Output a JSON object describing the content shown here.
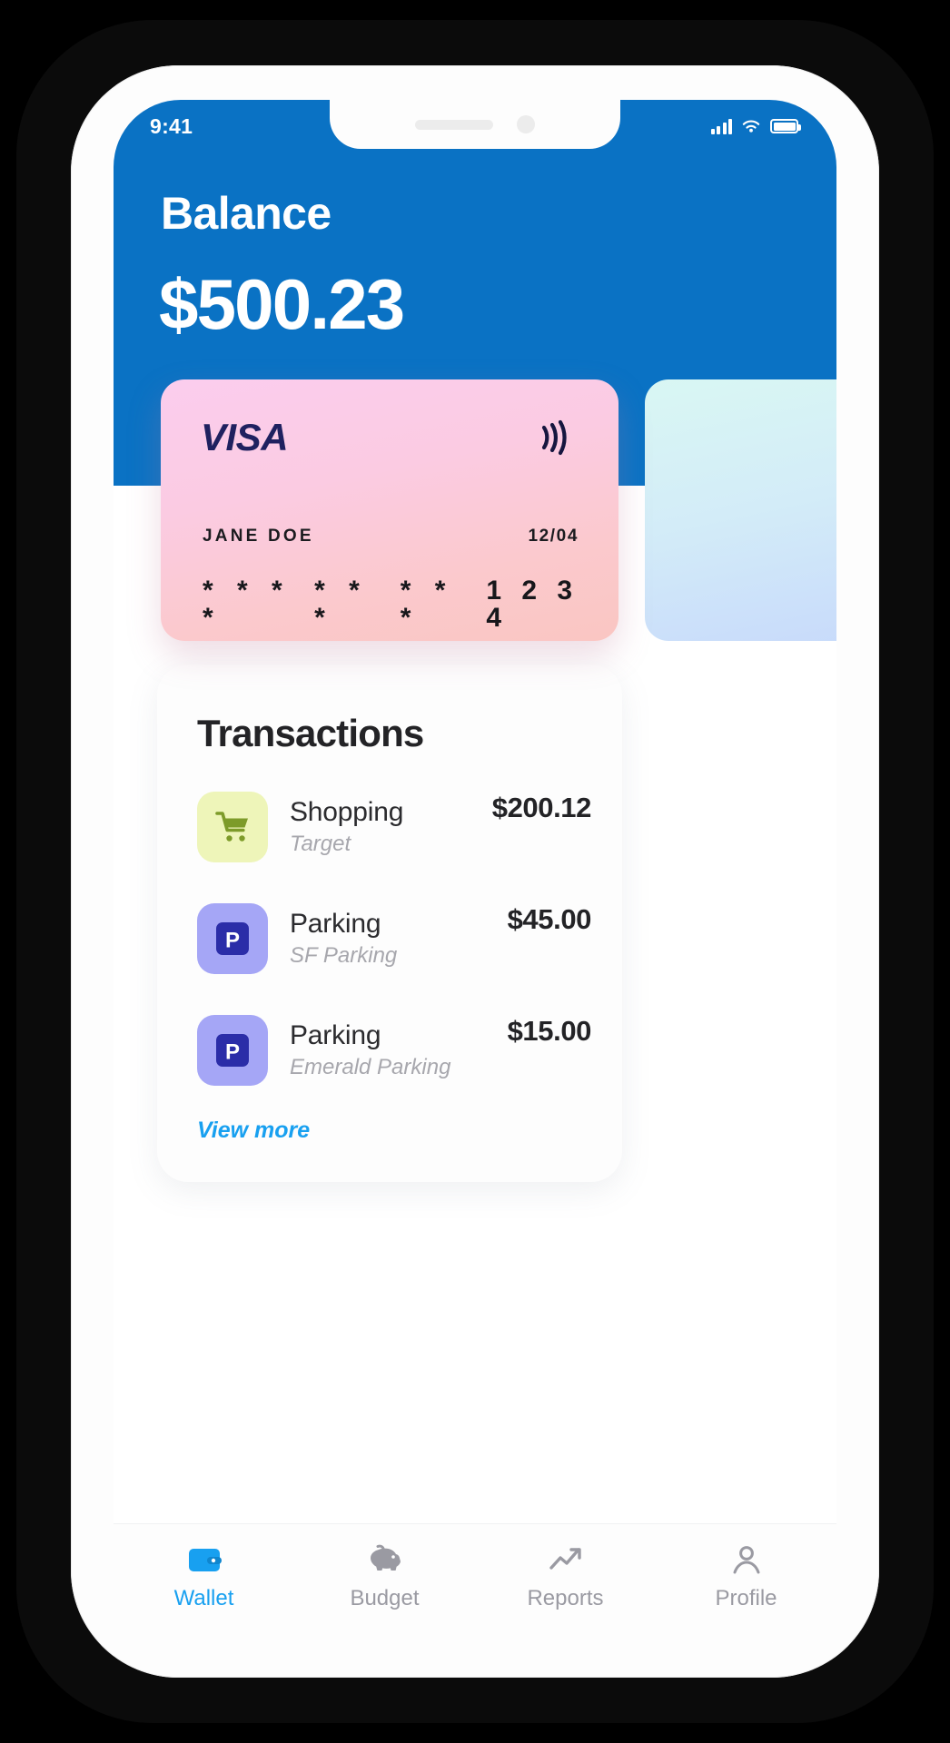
{
  "status_bar": {
    "time": "9:41",
    "icons": [
      "signal-bars-icon",
      "wifi-icon",
      "battery-icon"
    ]
  },
  "header": {
    "title": "Balance",
    "amount": "$500.23",
    "bg_color": "#0A72C4"
  },
  "card": {
    "brand": "VISA",
    "contactless_icon": "contactless-payment-icon",
    "holder_name": "JANE DOE",
    "expiry": "12/04",
    "masked_groups": [
      "* * * *",
      "* * *",
      "* * *"
    ],
    "last4": "1 2 3 4",
    "gradient_from": "#FBCDEE",
    "gradient_to": "#FAC6C2",
    "logo_color": "#1F2160"
  },
  "card_next": {
    "gradient_from": "#D9F7F3",
    "gradient_to": "#C7D9FB"
  },
  "transactions": {
    "title": "Transactions",
    "view_more_label": "View more",
    "view_more_color": "#18A0F0",
    "items": [
      {
        "category": "Shopping",
        "merchant": "Target",
        "amount": "$200.12",
        "icon": "shopping-cart-icon",
        "tile_color": "#EEF5B9",
        "icon_color": "#7D9B29"
      },
      {
        "category": "Parking",
        "merchant": "SF Parking",
        "amount": "$45.00",
        "icon": "parking-p-icon",
        "tile_color": "#A5A6F6",
        "icon_color": "#2B2DA8"
      },
      {
        "category": "Parking",
        "merchant": "Emerald Parking",
        "amount": "$15.00",
        "icon": "parking-p-icon",
        "tile_color": "#A5A6F6",
        "icon_color": "#2B2DA8"
      }
    ]
  },
  "bottom_nav": {
    "active_color": "#18A0F0",
    "inactive_color": "#9A9AA2",
    "items": [
      {
        "label": "Wallet",
        "icon": "wallet-icon",
        "active": true
      },
      {
        "label": "Budget",
        "icon": "piggy-bank-icon",
        "active": false
      },
      {
        "label": "Reports",
        "icon": "line-chart-icon",
        "active": false
      },
      {
        "label": "Profile",
        "icon": "person-icon",
        "active": false
      }
    ]
  }
}
